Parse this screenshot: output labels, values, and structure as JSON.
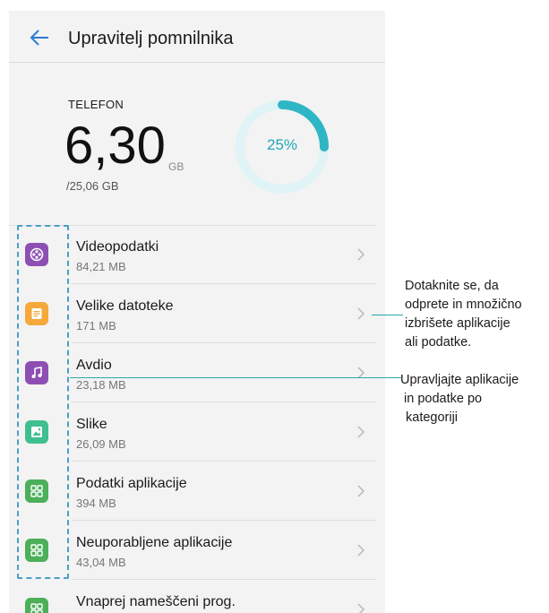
{
  "header": {
    "title": "Upravitelj pomnilnika"
  },
  "storage": {
    "label": "TELEFON",
    "used": "6,30",
    "unit": "GB",
    "total": "/25,06 GB",
    "percent_label": "25%",
    "percent": 0.25,
    "ring_color": "#2fb6c4",
    "track_color": "#e0f3f6"
  },
  "items": [
    {
      "title": "Videopodatki",
      "size": "84,21 MB",
      "icon": "video-reel-icon",
      "color": "#8e4fb3"
    },
    {
      "title": "Velike datoteke",
      "size": "171 MB",
      "icon": "document-icon",
      "color": "#f4a93a"
    },
    {
      "title": "Avdio",
      "size": "23,18 MB",
      "icon": "music-note-icon",
      "color": "#8e4fb3"
    },
    {
      "title": "Slike",
      "size": "26,09 MB",
      "icon": "image-icon",
      "color": "#3fbf8f"
    },
    {
      "title": "Podatki aplikacije",
      "size": "394 MB",
      "icon": "app-grid-icon",
      "color": "#4caf5a"
    },
    {
      "title": "Neuporabljene aplikacije",
      "size": "43,04 MB",
      "icon": "app-grid-icon",
      "color": "#4caf5a"
    },
    {
      "title": "Vnaprej nameščeni prog.",
      "size": "",
      "icon": "app-grid-icon",
      "color": "#4caf5a"
    }
  ],
  "callouts": {
    "delete": "Dotaknite se, da\nodprete in množično\nizbrišete aplikacije\nali podatke.",
    "manage": [
      "Upravljajte aplikacije",
      " in podatke po",
      "kategoriji"
    ]
  },
  "accent": "#2aa7b0"
}
